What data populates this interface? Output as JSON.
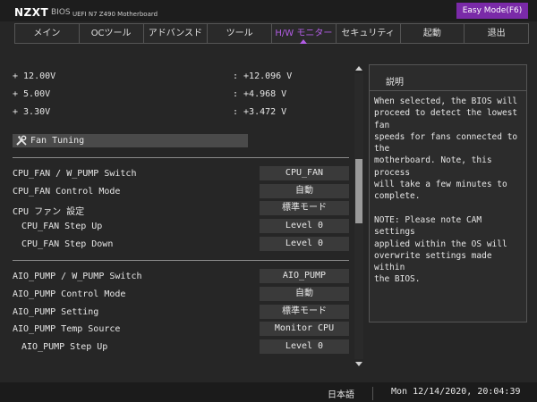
{
  "header": {
    "logo": "NZXT",
    "bios_word": "BIOS",
    "board_model": "UEFI N7 Z490 Motherboard",
    "easy_mode_button": "Easy Mode(F6)"
  },
  "tabs": [
    {
      "label": "メイン",
      "active": false
    },
    {
      "label": "OCツール",
      "active": false
    },
    {
      "label": "アドバンスド",
      "active": false
    },
    {
      "label": "ツール",
      "active": false
    },
    {
      "label": "H/W モニター",
      "active": true
    },
    {
      "label": "セキュリティ",
      "active": false
    },
    {
      "label": "起動",
      "active": false
    },
    {
      "label": "退出",
      "active": false
    }
  ],
  "voltages": [
    {
      "label": "+ 12.00V",
      "value": ": +12.096 V"
    },
    {
      "label": "+ 5.00V",
      "value": ": +4.968 V"
    },
    {
      "label": "+ 3.30V",
      "value": ": +3.472 V"
    }
  ],
  "section": {
    "label": "Fan Tuning",
    "icon": "wrench-screwdriver-icon"
  },
  "cpu_settings": [
    {
      "label": "CPU_FAN / W_PUMP Switch",
      "value": "CPU_FAN"
    },
    {
      "label": "CPU_FAN Control Mode",
      "value": "自動"
    },
    {
      "label": "CPU ファン 設定",
      "value": "標準モード"
    },
    {
      "label": "CPU_FAN Step Up",
      "value": "Level 0"
    },
    {
      "label": "CPU_FAN Step Down",
      "value": "Level 0"
    }
  ],
  "aio_settings": [
    {
      "label": "AIO_PUMP / W_PUMP Switch",
      "value": "AIO_PUMP"
    },
    {
      "label": "AIO_PUMP Control Mode",
      "value": "自動"
    },
    {
      "label": "AIO_PUMP Setting",
      "value": "標準モード"
    },
    {
      "label": "AIO_PUMP Temp Source",
      "value": "Monitor CPU"
    },
    {
      "label": "AIO_PUMP Step Up",
      "value": "Level 0"
    }
  ],
  "help": {
    "title": "説明",
    "text": "When selected, the BIOS will\nproceed to detect the lowest fan\nspeeds for fans connected to the\nmotherboard. Note, this process\nwill take a few minutes to\ncomplete.\n\nNOTE: Please note CAM settings\napplied within the OS will\noverwrite settings made within\nthe BIOS."
  },
  "footer": {
    "language": "日本語",
    "datetime": "Mon 12/14/2020, 20:04:39"
  },
  "colors": {
    "accent": "#b35de6",
    "easy_mode_bg": "#7a2aa8",
    "background": "#262626"
  }
}
